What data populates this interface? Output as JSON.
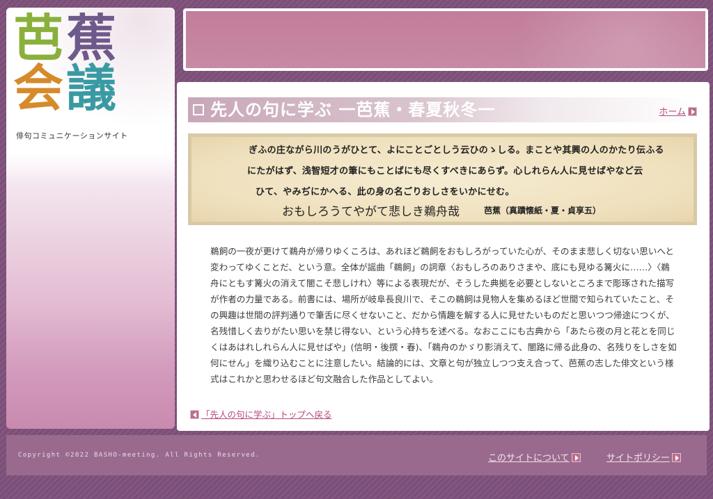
{
  "logo": {
    "chars": [
      "芭",
      "蕉",
      "会",
      "議"
    ],
    "subtitle": "俳句コミュニケーションサイト"
  },
  "header": {
    "title": "先人の句に学ぶ 一芭蕉・春夏秋冬一",
    "home_link": "ホーム"
  },
  "haiku": {
    "lines": [
      "ぎふの庄ながら川のうがひとて、よにことごとしう云ひのゝしる。まことや其興の人のかたり伝ふる",
      "にたがはず、浅智短才の筆にもことばにも尽くすべきにあらず。心しれらん人に見せばやなど云",
      "ひて、やみぢにかへる、此の身の名ごりおしさをいかにせむ。"
    ],
    "verse": "おもしろうてやがて悲しき鵜舟哉",
    "source": "芭蕉（真蹟懐紙・夏・貞享五）"
  },
  "commentary": "鵜飼の一夜が更けて鵜舟が帰りゆくころは、あれほど鵜飼をおもしろがっていた心が、そのまま悲しく切ない思いへと変わってゆくことだ、という意。全体が謡曲「鵜飼」の詞章〈おもしろのありさまや、底にも見ゆる篝火に……〉〈鵜舟にともす篝火の消えて闇こそ悲しけれ〉等による表現だが、そうした典拠を必要としないところまで彫琢された描写が作者の力量である。前書には、場所が岐阜長良川で、そこの鵜飼は見物人を集めるほど世間で知られていたこと、その興趣は世間の評判通りで筆舌に尽くせないこと、だから情趣を解する人に見せたいものだと思いつつ帰途につくが、名残惜しく去りがたい思いを禁じ得ない、という心持ちを述べる。なおここにも古典から「あたら夜の月と花とを同じくはあはれしれらん人に見せばや」(信明・後撰・春)、「鵜舟のかゞり影消えて、闇路に帰る此身の、名残りをしさを如何にせん」を織り込むことに注意したい。結論的には、文章と句が独立しつつ支え合って、芭蕉の志した俳文という様式はこれかと思わせるほど句文融合した作品としてよい。",
  "back_link": "「先人の句に学ぶ」トップへ戻る",
  "footer": {
    "copyright": "Copyright ©2022 BASHO-meeting. All Rights Reserved.",
    "about_link": "このサイトについて",
    "policy_link": "サイトポリシー"
  },
  "colors": {
    "background": "#7a4e76",
    "banner": "#c27d9c",
    "footer": "#9a6a8e",
    "link": "#b6487e"
  }
}
